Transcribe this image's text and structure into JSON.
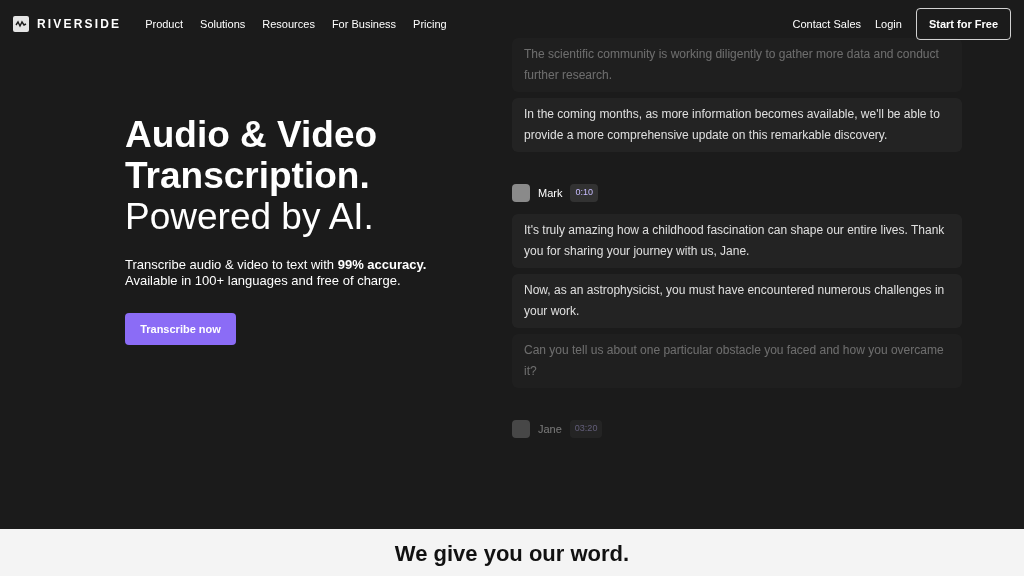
{
  "nav": {
    "logo": "RIVERSIDE",
    "links": [
      "Product",
      "Solutions",
      "Resources",
      "For Business",
      "Pricing"
    ],
    "right_links": [
      "Contact Sales",
      "Login"
    ],
    "cta": "Start for Free"
  },
  "hero": {
    "title_lines": [
      "Audio & Video",
      "Transcription."
    ],
    "subtitle": "Powered by AI.",
    "description_lines": [
      "Transcribe audio & video to text with **99% accuracy.**",
      "Available in 100+ languages and free of charge."
    ],
    "button": "Transcribe now"
  },
  "transcript": [
    {
      "kind": "messages",
      "items": [
        {
          "text": "The scientific community is working diligently to gather more data and conduct further research.",
          "dimmed": true
        },
        {
          "text": "In the coming months, as more information becomes available, we'll be able to provide a more comprehensive update on this remarkable discovery.",
          "dimmed": false
        }
      ]
    },
    {
      "kind": "speaker",
      "name": "Mark",
      "time": "0:10",
      "dimmed": false
    },
    {
      "kind": "messages",
      "items": [
        {
          "text": "It's truly amazing how a childhood fascination can shape our entire lives. Thank you for sharing your journey with us, Jane.",
          "dimmed": false
        },
        {
          "text": "Now, as an astrophysicist, you must have encountered numerous challenges in your work.",
          "dimmed": false
        },
        {
          "text": "Can you tell us about one particular obstacle you faced and how you overcame it?",
          "dimmed": true
        }
      ]
    },
    {
      "kind": "speaker",
      "name": "Jane",
      "time": "03:20",
      "dimmed": true
    }
  ],
  "footer_heading": "We give you our word."
}
